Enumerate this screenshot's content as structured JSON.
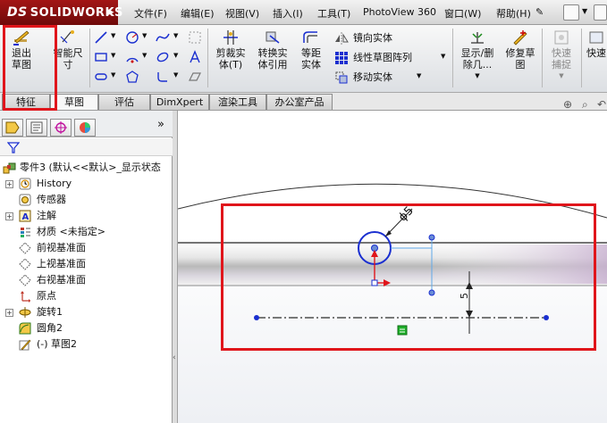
{
  "app": {
    "brand_prefix": "DS",
    "brand": "SOLIDWORKS"
  },
  "menu": [
    "文件(F)",
    "编辑(E)",
    "视图(V)",
    "插入(I)",
    "工具(T)",
    "PhotoView 360",
    "窗口(W)",
    "帮助(H)"
  ],
  "commands": {
    "exit_sketch": "退出草图",
    "smart_dimension": "智能尺寸",
    "trim_entities": "剪裁实体(T)",
    "convert_entities": "转换实体引用",
    "offset_entities": "等距实体",
    "mirror_entities": "镜向实体",
    "linear_pattern": "线性草图阵列",
    "move_entities": "移动实体",
    "display_delete_relations": "显示/删除几...",
    "repair_sketch": "修复草图",
    "quick_snaps": "快速捕捉",
    "quick_view": "快速"
  },
  "tabs": [
    "特征",
    "草图",
    "评估",
    "DimXpert",
    "渲染工具",
    "办公室产品"
  ],
  "active_tab": "草图",
  "tree": {
    "root": "零件3 (默认<<默认>_显示状态",
    "items": [
      {
        "label": "History",
        "icon": "history-icon",
        "expandable": true
      },
      {
        "label": "传感器",
        "icon": "sensor-icon",
        "expandable": false
      },
      {
        "label": "注解",
        "icon": "annotation-icon",
        "expandable": true
      },
      {
        "label": "材质 <未指定>",
        "icon": "material-icon",
        "expandable": false
      },
      {
        "label": "前视基准面",
        "icon": "plane-icon",
        "expandable": false
      },
      {
        "label": "上视基准面",
        "icon": "plane-icon",
        "expandable": false
      },
      {
        "label": "右视基准面",
        "icon": "plane-icon",
        "expandable": false
      },
      {
        "label": "原点",
        "icon": "origin-icon",
        "expandable": false
      },
      {
        "label": "旋转1",
        "icon": "revolve-icon",
        "expandable": true
      },
      {
        "label": "圆角2",
        "icon": "fillet-icon",
        "expandable": false
      },
      {
        "label": "(-) 草图2",
        "icon": "sketch-icon",
        "expandable": false
      }
    ]
  },
  "sketch": {
    "diameter_label": "ϕ5",
    "vertical_dim_label": "5"
  },
  "colors": {
    "highlight_box": "#e0151b",
    "sketch_blue": "#1a2fd0",
    "menu_bar": "#d4d4d4"
  }
}
